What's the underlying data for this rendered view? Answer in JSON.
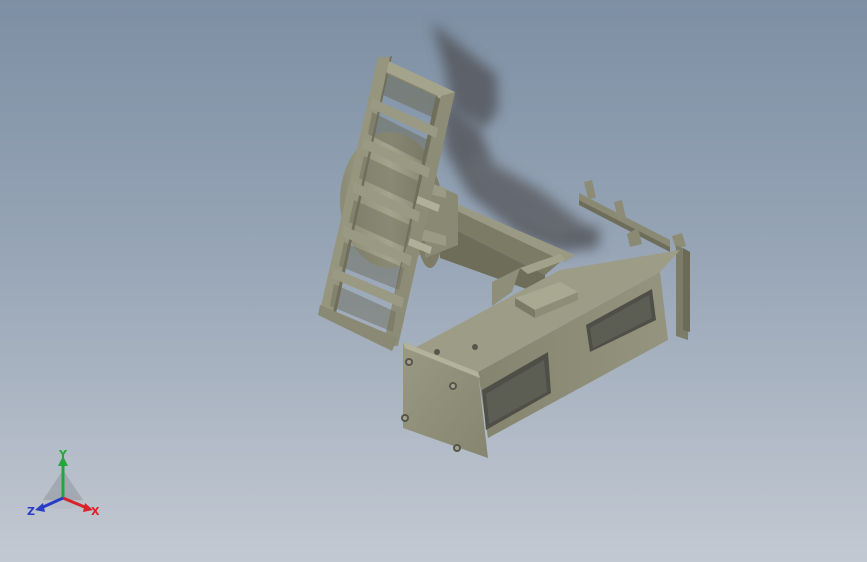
{
  "viewport": {
    "background_top": "#7d8fa4",
    "background_bottom": "#c3c9d2"
  },
  "model": {
    "body_color": "#8f8f78",
    "body_dark": "#6b6b57",
    "body_light": "#a7a78f",
    "shadow_color": "#4e5358"
  },
  "triad": {
    "x_label": "X",
    "y_label": "Y",
    "z_label": "Z",
    "x_color": "#d8232a",
    "y_color": "#27a53a",
    "z_color": "#2a3cc7"
  }
}
